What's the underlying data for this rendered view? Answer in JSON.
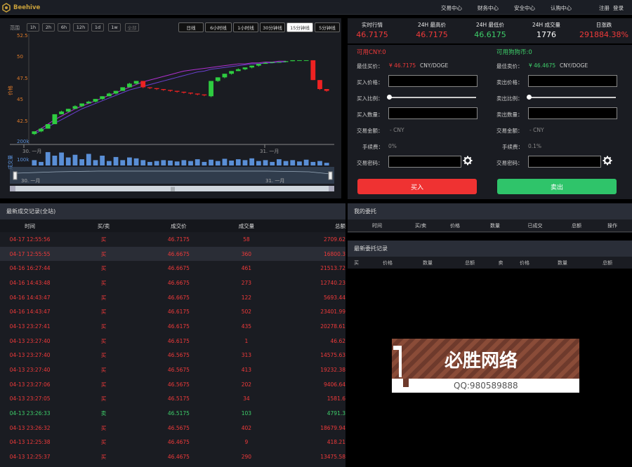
{
  "nav": {
    "brand": "Beehive",
    "links": [
      "交易中心",
      "财务中心",
      "安全中心",
      "认购中心",
      "注册",
      "登录"
    ]
  },
  "chart": {
    "range_label": "范围",
    "ranges": [
      "1h",
      "2h",
      "6h",
      "12h",
      "1d",
      "1w",
      "全部"
    ],
    "intervals": [
      "日线",
      "6小时线",
      "1小时线",
      "30分钟线",
      "15分钟线",
      "5分钟线"
    ],
    "selected_interval": "15分钟线",
    "y_ticks": [
      "52.5",
      "50",
      "47.5",
      "45",
      "42.5"
    ],
    "y_axis_label": "价格",
    "vol_ticks": [
      "200k",
      "100k"
    ],
    "vol_axis_label": "成交量",
    "x_labels": [
      "30. 一月",
      "31. 一月"
    ],
    "nav_labels": [
      "30. 一月",
      "31. 一月"
    ],
    "colors": {
      "up": "#2ecc40",
      "down": "#ee2222",
      "ma1": "#b030d0",
      "ma2": "#6a3fd0",
      "volume": "#5a8fd6"
    }
  },
  "chart_data": {
    "type": "candlestick",
    "y_axis": {
      "label": "价格",
      "ticks": [
        52.5,
        50,
        47.5,
        45,
        42.5
      ],
      "range": [
        41,
        53
      ]
    },
    "x_ticks": [
      "30. 一月",
      "31. 一月"
    ],
    "candles": [
      {
        "o": 42.0,
        "c": 42.3,
        "h": 42.3,
        "l": 41.9
      },
      {
        "o": 42.3,
        "c": 42.6,
        "h": 42.7,
        "l": 42.2
      },
      {
        "o": 42.6,
        "c": 43.1,
        "h": 43.1,
        "l": 42.6
      },
      {
        "o": 43.1,
        "c": 44.2,
        "h": 44.2,
        "l": 43.1
      },
      {
        "o": 44.2,
        "c": 44.5,
        "h": 44.6,
        "l": 44.2
      },
      {
        "o": 44.5,
        "c": 44.8,
        "h": 44.8,
        "l": 44.4
      },
      {
        "o": 44.8,
        "c": 45.1,
        "h": 45.2,
        "l": 44.8
      },
      {
        "o": 45.1,
        "c": 45.4,
        "h": 45.4,
        "l": 45.0
      },
      {
        "o": 45.4,
        "c": 45.6,
        "h": 45.7,
        "l": 45.4
      },
      {
        "o": 45.6,
        "c": 45.9,
        "h": 45.9,
        "l": 45.5
      },
      {
        "o": 45.9,
        "c": 46.2,
        "h": 46.2,
        "l": 45.8
      },
      {
        "o": 46.2,
        "c": 46.5,
        "h": 46.6,
        "l": 46.2
      },
      {
        "o": 46.5,
        "c": 46.8,
        "h": 46.8,
        "l": 46.4
      },
      {
        "o": 46.8,
        "c": 47.2,
        "h": 47.2,
        "l": 46.8
      },
      {
        "o": 47.2,
        "c": 47.6,
        "h": 47.7,
        "l": 47.2
      },
      {
        "o": 47.6,
        "c": 47.9,
        "h": 47.9,
        "l": 47.5
      },
      {
        "o": 47.9,
        "c": 47.2,
        "h": 47.9,
        "l": 47.1
      },
      {
        "o": 47.2,
        "c": 47.1,
        "h": 47.2,
        "l": 47.0
      },
      {
        "o": 47.1,
        "c": 47.0,
        "h": 47.1,
        "l": 46.9
      },
      {
        "o": 47.0,
        "c": 46.9,
        "h": 47.0,
        "l": 46.8
      },
      {
        "o": 46.9,
        "c": 46.8,
        "h": 46.9,
        "l": 46.7
      },
      {
        "o": 46.8,
        "c": 46.7,
        "h": 46.8,
        "l": 46.6
      },
      {
        "o": 46.7,
        "c": 46.6,
        "h": 46.7,
        "l": 46.5
      },
      {
        "o": 46.6,
        "c": 46.5,
        "h": 46.6,
        "l": 46.4
      },
      {
        "o": 46.5,
        "c": 46.4,
        "h": 46.5,
        "l": 46.3
      },
      {
        "o": 46.4,
        "c": 46.3,
        "h": 46.4,
        "l": 46.2
      },
      {
        "o": 46.2,
        "c": 47.9,
        "h": 47.9,
        "l": 46.1
      },
      {
        "o": 47.9,
        "c": 48.3,
        "h": 48.3,
        "l": 47.8
      },
      {
        "o": 48.3,
        "c": 48.7,
        "h": 48.7,
        "l": 48.2
      },
      {
        "o": 48.7,
        "c": 49.0,
        "h": 49.0,
        "l": 48.6
      },
      {
        "o": 49.0,
        "c": 49.2,
        "h": 49.3,
        "l": 49.0
      },
      {
        "o": 49.2,
        "c": 49.4,
        "h": 49.4,
        "l": 49.1
      },
      {
        "o": 49.4,
        "c": 49.6,
        "h": 49.6,
        "l": 49.3
      },
      {
        "o": 49.6,
        "c": 49.8,
        "h": 49.8,
        "l": 49.5
      },
      {
        "o": 49.8,
        "c": 49.9,
        "h": 50.0,
        "l": 49.8
      },
      {
        "o": 49.9,
        "c": 50.0,
        "h": 50.0,
        "l": 49.9
      },
      {
        "o": 50.0,
        "c": 50.0,
        "h": 50.0,
        "l": 50.0
      },
      {
        "o": 50.0,
        "c": 50.1,
        "h": 50.1,
        "l": 50.0
      },
      {
        "o": 50.1,
        "c": 50.2,
        "h": 50.2,
        "l": 50.1
      },
      {
        "o": 50.2,
        "c": 50.2,
        "h": 50.2,
        "l": 50.2
      },
      {
        "o": 50.2,
        "c": 50.2,
        "h": 50.2,
        "l": 50.2
      },
      {
        "o": 50.2,
        "c": 48.0,
        "h": 50.2,
        "l": 48.0
      },
      {
        "o": 48.0,
        "c": 47.0,
        "h": 48.0,
        "l": 46.9
      },
      {
        "o": 47.0,
        "c": 46.8,
        "h": 47.0,
        "l": 46.7
      }
    ],
    "ma_fast": [
      42.2,
      42.6,
      43.1,
      43.6,
      44.0,
      44.4,
      44.8,
      45.1,
      45.4,
      45.7,
      46.0,
      46.3,
      46.6,
      46.9,
      47.2,
      47.5,
      47.8,
      48.0,
      48.2,
      48.4,
      48.6,
      48.8,
      49.0,
      49.1,
      49.2,
      49.3,
      49.4,
      49.5,
      49.6,
      49.7,
      49.8,
      49.8,
      49.9,
      49.9,
      50.0,
      50.0,
      50.1,
      50.1
    ],
    "ma_slow": [
      42.0,
      42.4,
      42.8,
      43.2,
      43.6,
      44.0,
      44.4,
      44.8,
      45.1,
      45.4,
      45.7,
      46.0,
      46.3,
      46.6,
      46.9,
      47.1,
      47.3,
      47.5,
      47.7,
      47.9,
      48.1,
      48.3,
      48.5,
      48.7,
      48.9,
      49.0,
      49.2,
      49.3,
      49.4,
      49.5,
      49.6,
      49.7,
      49.8,
      49.8,
      49.9,
      49.9,
      50.0,
      50.0
    ],
    "volume_axis": {
      "label": "成交量",
      "ticks": [
        "200k",
        "100k"
      ],
      "max": 220000
    },
    "volumes": [
      60000,
      40000,
      150000,
      110000,
      145000,
      90000,
      120000,
      70000,
      130000,
      60000,
      110000,
      50000,
      95000,
      60000,
      90000,
      80000,
      60000,
      40000,
      50000,
      60000,
      55000,
      45000,
      60000,
      50000,
      70000,
      40000,
      65000,
      50000,
      75000,
      55000,
      70000,
      60000,
      80000,
      50000,
      60000,
      40000,
      70000,
      50000,
      60000,
      45000,
      65000,
      40000,
      50000,
      30000
    ]
  },
  "ticker": [
    {
      "label": "实时行情",
      "value": "46.7175",
      "color": "#f03a3a"
    },
    {
      "label": "24H 最高价",
      "value": "46.7175",
      "color": "#f03a3a"
    },
    {
      "label": "24H 最低价",
      "value": "46.6175",
      "color": "#3ecf6a"
    },
    {
      "label": "24H 成交量",
      "value": "1776",
      "color": "#ffffff"
    },
    {
      "label": "日涨跌",
      "value": "291884.38%",
      "color": "#f03a3a"
    }
  ],
  "buy": {
    "available": "可用CNY:0",
    "best_label": "最佳买价：",
    "best_value": "¥ 46.7175",
    "best_unit": "CNY/DOGE",
    "price_label": "买入价格：",
    "ratio_label": "买入比例：",
    "amount_label": "买入数量：",
    "total_label": "交易金额：",
    "total_value": "- CNY",
    "fee_label": "手续费：",
    "fee_value": "0%",
    "pwd_label": "交易密码：",
    "button": "买入"
  },
  "sell": {
    "available": "可用狗狗币:0",
    "best_label": "最佳卖价：",
    "best_value": "¥ 46.4675",
    "best_unit": "CNY/DOGE",
    "price_label": "卖出价格：",
    "ratio_label": "卖出比例：",
    "amount_label": "卖出数量：",
    "total_label": "交易金额：",
    "total_value": "- CNY",
    "fee_label": "手续费：",
    "fee_value": "0.1%",
    "pwd_label": "交易密码：",
    "button": "卖出"
  },
  "trades": {
    "title": "最新成交记录(全站)",
    "headers": [
      "时间",
      "买/卖",
      "成交价",
      "成交量",
      "总额"
    ],
    "rows": [
      {
        "time": "04-17 12:55:56",
        "side": "买",
        "price": "46.7175",
        "vol": "58",
        "total": "2709.62",
        "up": false
      },
      {
        "time": "04-17 12:55:55",
        "side": "买",
        "price": "46.6675",
        "vol": "360",
        "total": "16800.3",
        "up": false
      },
      {
        "time": "04-16 16:27:44",
        "side": "买",
        "price": "46.6675",
        "vol": "461",
        "total": "21513.72",
        "up": false
      },
      {
        "time": "04-16 14:43:48",
        "side": "买",
        "price": "46.6675",
        "vol": "273",
        "total": "12740.23",
        "up": false
      },
      {
        "time": "04-16 14:43:47",
        "side": "买",
        "price": "46.6675",
        "vol": "122",
        "total": "5693.44",
        "up": false
      },
      {
        "time": "04-16 14:43:47",
        "side": "买",
        "price": "46.6175",
        "vol": "502",
        "total": "23401.99",
        "up": false
      },
      {
        "time": "04-13 23:27:41",
        "side": "买",
        "price": "46.6175",
        "vol": "435",
        "total": "20278.61",
        "up": false
      },
      {
        "time": "04-13 23:27:40",
        "side": "买",
        "price": "46.6175",
        "vol": "1",
        "total": "46.62",
        "up": false
      },
      {
        "time": "04-13 23:27:40",
        "side": "买",
        "price": "46.5675",
        "vol": "313",
        "total": "14575.63",
        "up": false
      },
      {
        "time": "04-13 23:27:40",
        "side": "买",
        "price": "46.5675",
        "vol": "413",
        "total": "19232.38",
        "up": false
      },
      {
        "time": "04-13 23:27:06",
        "side": "买",
        "price": "46.5675",
        "vol": "202",
        "total": "9406.64",
        "up": false
      },
      {
        "time": "04-13 23:27:05",
        "side": "买",
        "price": "46.5175",
        "vol": "34",
        "total": "1581.6",
        "up": false
      },
      {
        "time": "04-13 23:26:33",
        "side": "卖",
        "price": "46.5175",
        "vol": "103",
        "total": "4791.3",
        "up": true
      },
      {
        "time": "04-13 23:26:32",
        "side": "买",
        "price": "46.5675",
        "vol": "402",
        "total": "18679.94",
        "up": false
      },
      {
        "time": "04-13 12:25:38",
        "side": "买",
        "price": "46.4675",
        "vol": "9",
        "total": "418.21",
        "up": false
      },
      {
        "time": "04-13 12:25:37",
        "side": "买",
        "price": "46.4675",
        "vol": "290",
        "total": "13475.58",
        "up": false
      }
    ]
  },
  "my_orders": {
    "title": "我的委托",
    "headers": [
      "时间",
      "买/卖",
      "价格",
      "数量",
      "已成交",
      "总额",
      "操作"
    ]
  },
  "recent_orders": {
    "title": "最新委托记录",
    "headers": [
      "买",
      "价格",
      "数量",
      "总额",
      "卖",
      "价格",
      "数量",
      "总额"
    ]
  },
  "ad": {
    "title": "必胜网络",
    "contact": "QQ:980589888"
  }
}
